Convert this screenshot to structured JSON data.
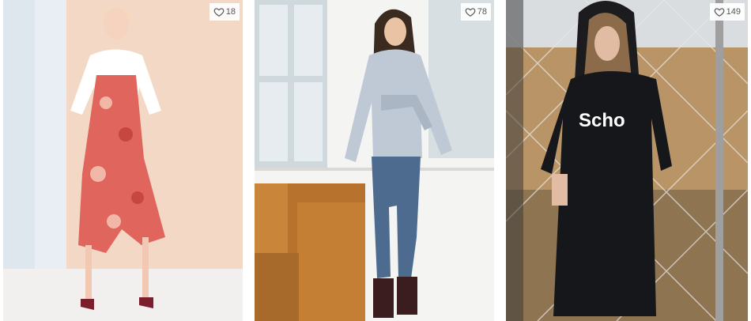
{
  "products": [
    {
      "likes": "18",
      "heart_icon": "heart-outline-icon"
    },
    {
      "likes": "78",
      "heart_icon": "heart-outline-icon"
    },
    {
      "likes": "149",
      "heart_icon": "heart-outline-icon",
      "print_text": "Scho"
    }
  ],
  "colors": {
    "badge_bg": "#ffffff",
    "badge_text": "#555555"
  }
}
